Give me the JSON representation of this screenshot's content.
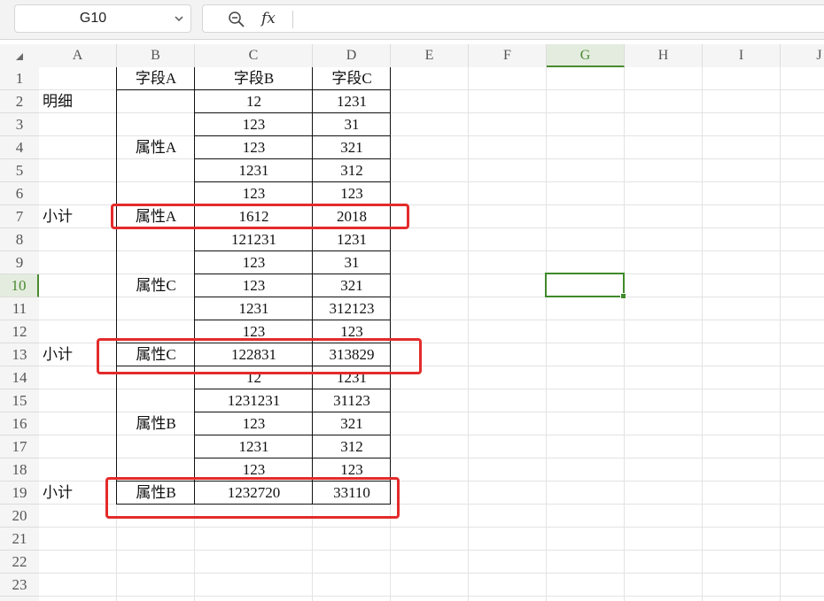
{
  "name_box": {
    "value": "G10"
  },
  "formula_bar": {
    "fx_label": "fx",
    "value": ""
  },
  "columns": [
    "A",
    "B",
    "C",
    "D",
    "E",
    "F",
    "G",
    "H",
    "I",
    "J"
  ],
  "selected_column": "G",
  "rows": [
    "1",
    "2",
    "3",
    "4",
    "5",
    "6",
    "7",
    "8",
    "9",
    "10",
    "11",
    "12",
    "13",
    "14",
    "15",
    "16",
    "17",
    "18",
    "19",
    "20",
    "21",
    "22",
    "23"
  ],
  "selected_row": "10",
  "cells": {
    "B1": "字段A",
    "C1": "字段B",
    "D1": "字段C",
    "A2": "明细",
    "C2": "12",
    "D2": "1231",
    "C3": "123",
    "D3": "31",
    "B4": "属性A",
    "C4": "123",
    "D4": "321",
    "C5": "1231",
    "D5": "312",
    "C6": "123",
    "D6": "123",
    "A7": "小计",
    "B7": "属性A",
    "C7": "1612",
    "D7": "2018",
    "C8": "121231",
    "D8": "1231",
    "C9": "123",
    "D9": "31",
    "B10": "属性C",
    "C10": "123",
    "D10": "321",
    "C11": "1231",
    "D11": "312123",
    "C12": "123",
    "D12": "123",
    "A13": "小计",
    "B13": "属性C",
    "C13": "122831",
    "D13": "313829",
    "C14": "12",
    "D14": "1231",
    "C15": "1231231",
    "D15": "31123",
    "B16": "属性B",
    "C16": "123",
    "D16": "321",
    "C17": "1231",
    "D17": "312",
    "C18": "123",
    "D18": "123",
    "A19": "小计",
    "B19": "属性B",
    "C19": "1232720",
    "D19": "33110"
  },
  "colors": {
    "selection": "#3f8a2a",
    "highlight": "#e32b2b"
  }
}
